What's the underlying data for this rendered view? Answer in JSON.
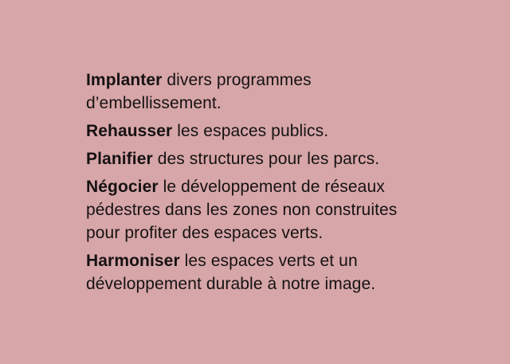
{
  "items": [
    {
      "keyword": "Implanter",
      "line1": " divers programmes",
      "line2": "d’embellissement.",
      "line3": ""
    },
    {
      "keyword": "Rehausser",
      "line1": " les espaces publics.",
      "line2": "",
      "line3": ""
    },
    {
      "keyword": "Planifier",
      "line1": " des structures pour les parcs.",
      "line2": "",
      "line3": ""
    },
    {
      "keyword": "Négocier",
      "line1": " le développement de réseaux",
      "line2": "pédestres dans les zones non construites",
      "line3": "pour profiter des espaces verts."
    },
    {
      "keyword": "Harmoniser",
      "line1": " les espaces verts et un",
      "line2": "développement durable à notre image.",
      "line3": ""
    }
  ]
}
